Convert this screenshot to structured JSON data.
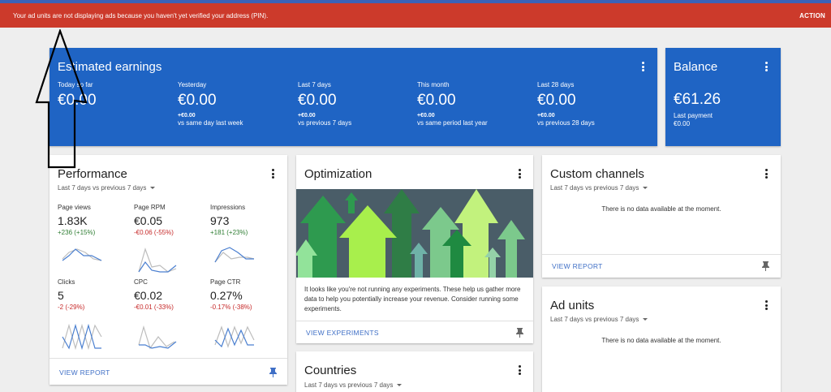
{
  "alert": {
    "message": "Your ad units are not displaying ads because you haven't yet verified your address (PIN).",
    "action": "ACTION"
  },
  "estimated_earnings": {
    "title": "Estimated earnings",
    "stats": [
      {
        "label": "Today so far",
        "value": "€0.00",
        "delta": "",
        "compare": ""
      },
      {
        "label": "Yesterday",
        "value": "€0.00",
        "delta": "+€0.00",
        "compare": "vs same day last week"
      },
      {
        "label": "Last 7 days",
        "value": "€0.00",
        "delta": "+€0.00",
        "compare": "vs previous 7 days"
      },
      {
        "label": "This month",
        "value": "€0.00",
        "delta": "+€0.00",
        "compare": "vs same period last year"
      },
      {
        "label": "Last 28 days",
        "value": "€0.00",
        "delta": "+€0.00",
        "compare": "vs previous 28 days"
      }
    ]
  },
  "balance": {
    "title": "Balance",
    "value": "€61.26",
    "last_payment_label": "Last payment",
    "last_payment_value": "€0.00"
  },
  "performance": {
    "title": "Performance",
    "period": "Last 7 days vs previous 7 days",
    "metrics": [
      {
        "label": "Page views",
        "value": "1.83K",
        "delta": "+236 (+15%)",
        "trend": "positive"
      },
      {
        "label": "Page RPM",
        "value": "€0.05",
        "delta": "-€0.06 (-55%)",
        "trend": "negative"
      },
      {
        "label": "Impressions",
        "value": "973",
        "delta": "+181 (+23%)",
        "trend": "positive"
      },
      {
        "label": "Clicks",
        "value": "5",
        "delta": "-2 (-29%)",
        "trend": "negative"
      },
      {
        "label": "CPC",
        "value": "€0.02",
        "delta": "-€0.01 (-33%)",
        "trend": "negative"
      },
      {
        "label": "Page CTR",
        "value": "0.27%",
        "delta": "-0.17% (-38%)",
        "trend": "negative"
      }
    ],
    "link": "VIEW REPORT"
  },
  "optimization": {
    "title": "Optimization",
    "text": "It looks like you're not running any experiments. These help us gather more data to help you potentially increase your revenue. Consider running some experiments.",
    "link": "VIEW EXPERIMENTS"
  },
  "countries": {
    "title": "Countries",
    "period": "Last 7 days vs previous 7 days"
  },
  "custom_channels": {
    "title": "Custom channels",
    "period": "Last 7 days vs previous 7 days",
    "empty": "There is no data available at the moment.",
    "link": "VIEW REPORT"
  },
  "ad_units": {
    "title": "Ad units",
    "period": "Last 7 days vs previous 7 days",
    "empty": "There is no data available at the moment."
  },
  "colors": {
    "alert": "#cc3a2b",
    "card_blue": "#1f64c4",
    "link": "#3f6fc6",
    "positive": "#2e7d32",
    "negative": "#c62828"
  },
  "icons": [
    "more-vert-icon",
    "dropdown-arrow-icon",
    "pin-icon",
    "up-arrow-annotation"
  ]
}
